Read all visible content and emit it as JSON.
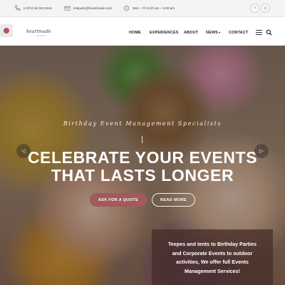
{
  "topbar": {
    "phone": "(+971) 55 523 5544",
    "email": "letsparty@heartmade.com",
    "hours": "Mon – Fri 9.00 am – 6.00 pm",
    "social_icons": [
      "facebook-icon",
      "instagram-icon"
    ],
    "social_glyphs": [
      "f",
      "◎"
    ]
  },
  "header": {
    "logo_text": "heartmade",
    "logo_subtext": "EVENTS",
    "nav": {
      "home": "HOME",
      "experiences": "EXPERIENCES",
      "about": "ABOUT",
      "news": "NEWS",
      "contact": "CONTACT"
    }
  },
  "hero": {
    "kicker": "Birthday Event Management Specialists",
    "title_line1": "CELEBRATE YOUR EVENTS",
    "title_line2": "THAT LASTS LONGER",
    "cta_primary": "ASK FOR A QUOTE",
    "cta_secondary": "READ MORE",
    "prev_glyph": "◁",
    "next_glyph": "▷",
    "info_text": "Teepes and tents to Birthday Parties and Corporate Events to outdoor activities, We offer full Events Management Services!"
  },
  "colors": {
    "accent": "#a25a5a",
    "topbar_bg": "#f4f4f4",
    "infobox_bg": "#463028"
  }
}
